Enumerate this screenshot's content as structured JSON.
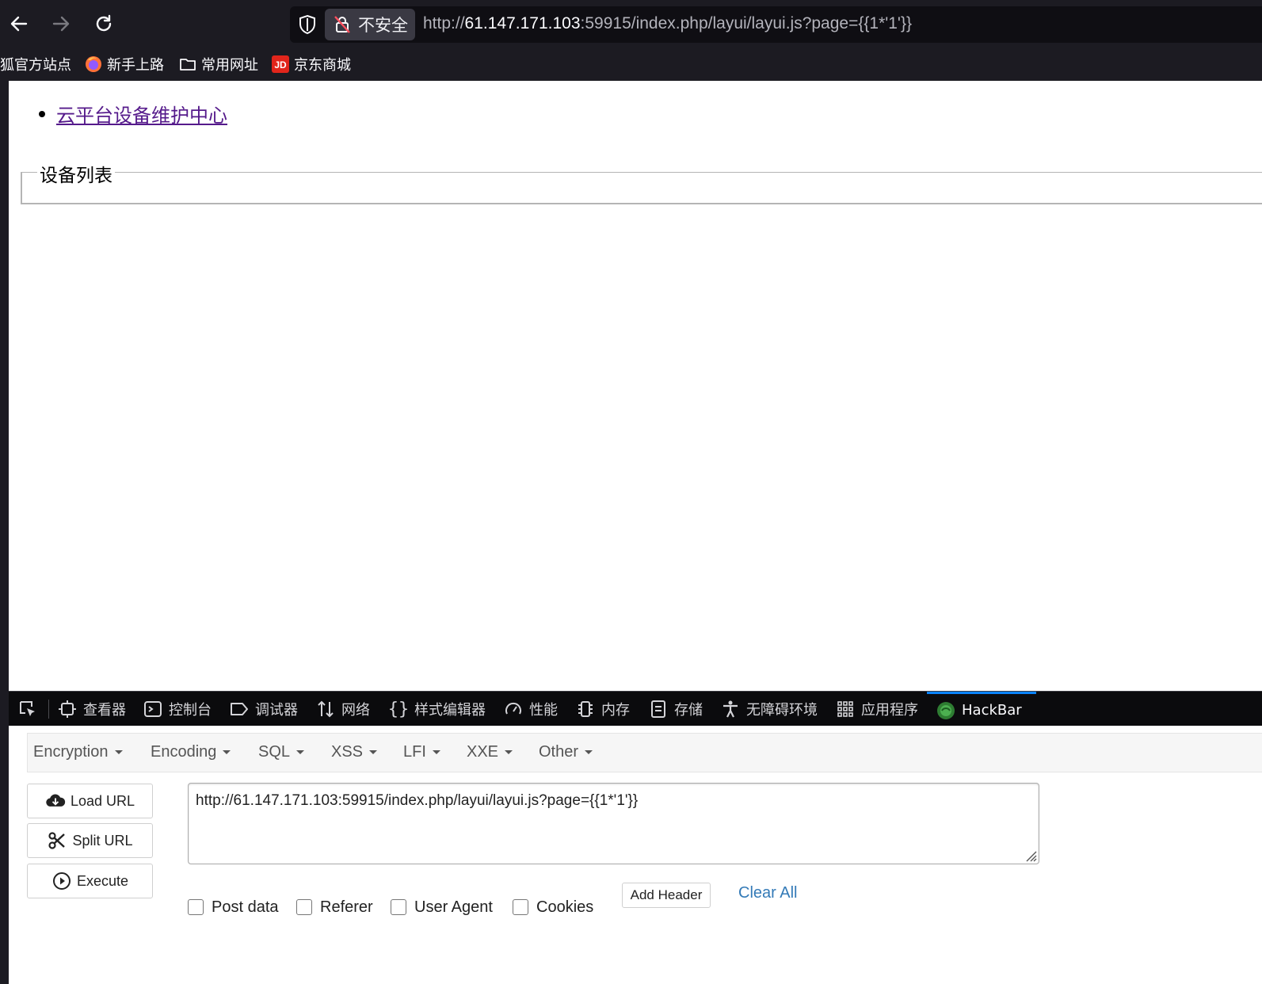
{
  "browser": {
    "security_label": "不安全",
    "url_prefix": "http://",
    "url_host": "61.147.171.103",
    "url_rest": ":59915/index.php/layui/layui.js?page={{1*'1'}}"
  },
  "bookmarks": [
    {
      "label": "狐官方站点"
    },
    {
      "label": "新手上路"
    },
    {
      "label": "常用网址"
    },
    {
      "label": "京东商城"
    }
  ],
  "page": {
    "link_text": "云平台设备维护中心",
    "fieldset_legend": "设备列表"
  },
  "devtools": {
    "tabs": [
      {
        "label": "查看器"
      },
      {
        "label": "控制台"
      },
      {
        "label": "调试器"
      },
      {
        "label": "网络"
      },
      {
        "label": "样式编辑器"
      },
      {
        "label": "性能"
      },
      {
        "label": "内存"
      },
      {
        "label": "存储"
      },
      {
        "label": "无障碍环境"
      },
      {
        "label": "应用程序"
      },
      {
        "label": "HackBar"
      }
    ],
    "active_tab": "HackBar"
  },
  "hackbar": {
    "menus": [
      "Encryption",
      "Encoding",
      "SQL",
      "XSS",
      "LFI",
      "XXE",
      "Other"
    ],
    "buttons": {
      "load_url": "Load URL",
      "split_url": "Split URL",
      "execute": "Execute"
    },
    "url_value": "http://61.147.171.103:59915/index.php/layui/layui.js?page={{1*'1'}}",
    "options": {
      "post_data": "Post data",
      "referer": "Referer",
      "user_agent": "User Agent",
      "cookies": "Cookies"
    },
    "add_header": "Add Header",
    "clear_all": "Clear All"
  },
  "colors": {
    "chrome_bg": "#1c1b22",
    "link_visited": "#551a8b",
    "active_tab_accent": "#0a84ff",
    "clear_all_link": "#337ab7"
  }
}
